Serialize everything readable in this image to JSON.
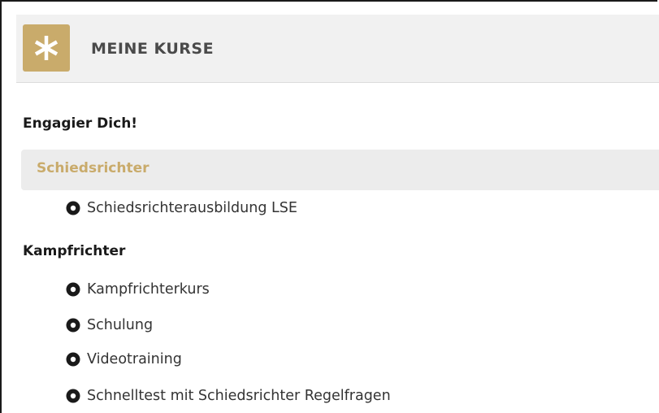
{
  "header": {
    "title": "MEINE KURSE",
    "icon": "asterisk-icon",
    "accent_color": "#c9ab6b"
  },
  "categories": [
    {
      "label": "Engagier Dich!",
      "active": false,
      "items": []
    },
    {
      "label": "Schiedsrichter",
      "active": true,
      "items": [
        {
          "label": "Schiedsrichterausbildung LSE"
        }
      ]
    },
    {
      "label": "Kampfrichter",
      "active": false,
      "items": [
        {
          "label": "Kampfrichterkurs"
        },
        {
          "label": "Schulung"
        },
        {
          "label": "Videotraining"
        },
        {
          "label": "Schnelltest mit Schiedsrichter Regelfragen"
        }
      ]
    }
  ]
}
